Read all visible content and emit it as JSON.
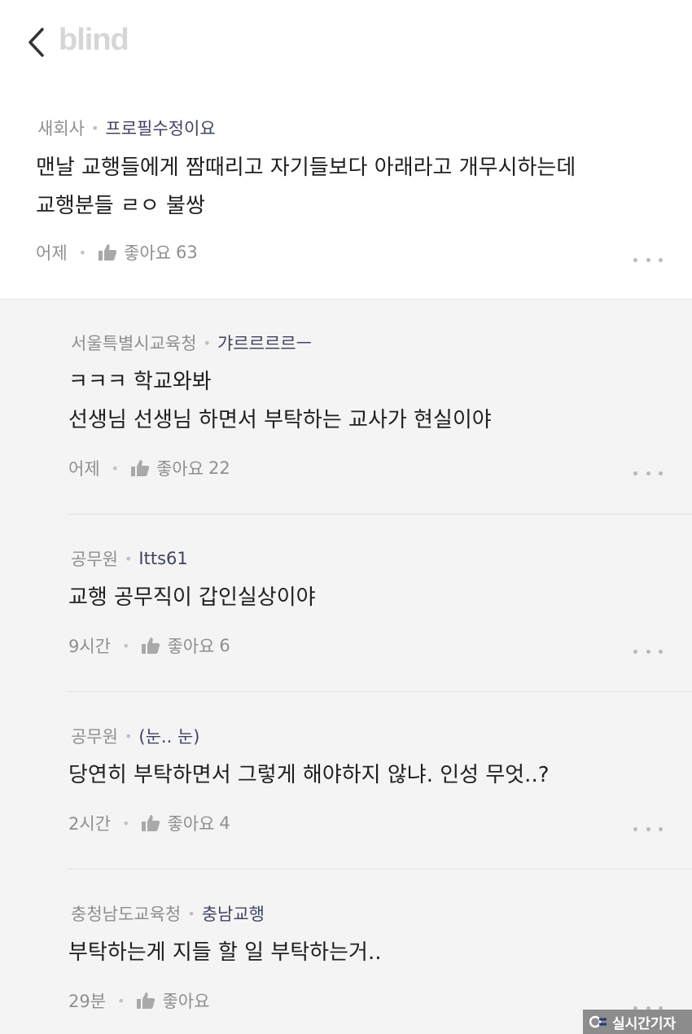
{
  "header": {
    "logo": "blind"
  },
  "top_comment": {
    "company": "새회사",
    "nickname": "프로필수정이요",
    "lines": [
      "맨날 교행들에게 짬때리고 자기들보다 아래라고 개무시하는데",
      "교행분들 ㄹㅇ 불쌍"
    ],
    "time": "어제",
    "like_label": "좋아요",
    "like_count": "63"
  },
  "replies": [
    {
      "company": "서울특별시교육청",
      "nickname": "갸르르르르ㅡ",
      "lines": [
        "ㅋㅋㅋ 학교와봐",
        "선생님 선생님 하면서 부탁하는 교사가 현실이야"
      ],
      "time": "어제",
      "like_label": "좋아요",
      "like_count": "22"
    },
    {
      "company": "공무원",
      "nickname": "Itts61",
      "lines": [
        "교행 공무직이 갑인실상이야"
      ],
      "time": "9시간",
      "like_label": "좋아요",
      "like_count": "6"
    },
    {
      "company": "공무원",
      "nickname": "(눈.. 눈)",
      "lines": [
        "당연히 부탁하면서 그렇게 해야하지 않냐. 인성 무엇..?"
      ],
      "time": "2시간",
      "like_label": "좋아요",
      "like_count": "4"
    },
    {
      "company": "충청남도교육청",
      "nickname": "충남교행",
      "lines": [
        "부탁하는게 지들 할 일 부탁하는거.."
      ],
      "time": "29분",
      "like_label": "좋아요",
      "like_count": ""
    }
  ],
  "watermark": {
    "text": "실시간기자"
  },
  "colors": {
    "reply_background": "#f4f4f5",
    "nickname": "#3e4560",
    "meta_gray": "#8f8f8f",
    "logo_gray": "#d6d6d6"
  },
  "icons": {
    "back": "chevron-left-icon",
    "like": "thumbs-up-icon",
    "more": "more-dots-icon"
  }
}
